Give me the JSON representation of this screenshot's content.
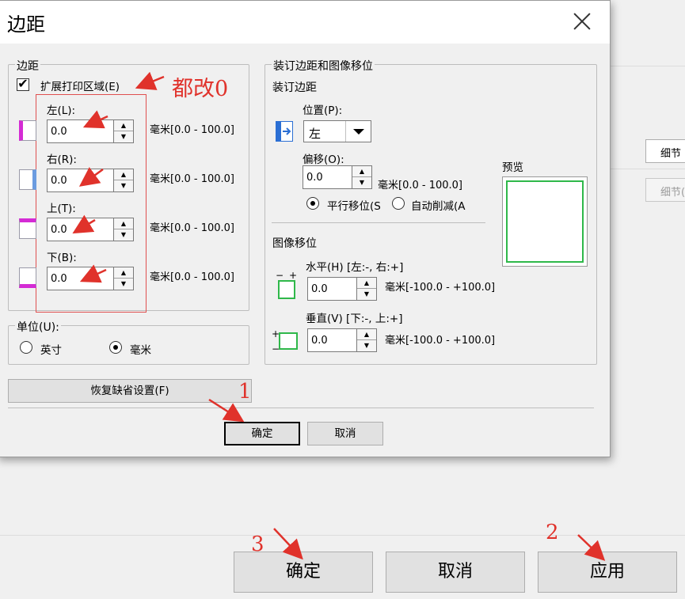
{
  "background": {
    "detail_button": "细节",
    "detail_button2": "细节(",
    "ok": "确定",
    "cancel": "取消",
    "apply": "应用"
  },
  "dialog": {
    "title": "边距",
    "margins_group": {
      "legend": "边距",
      "expand_checkbox": {
        "label": "扩展打印区域(E)",
        "checked": true
      },
      "fields": [
        {
          "label": "左(L):",
          "value": "0.0",
          "unit": "毫米[0.0 - 100.0]",
          "icon": "left-margin-icon"
        },
        {
          "label": "右(R):",
          "value": "0.0",
          "unit": "毫米[0.0 - 100.0]",
          "icon": "right-margin-icon"
        },
        {
          "label": "上(T):",
          "value": "0.0",
          "unit": "毫米[0.0 - 100.0]",
          "icon": "top-margin-icon"
        },
        {
          "label": "下(B):",
          "value": "0.0",
          "unit": "毫米[0.0 - 100.0]",
          "icon": "bottom-margin-icon"
        }
      ]
    },
    "unit_group": {
      "legend": "单位(U):",
      "options": [
        {
          "label": "英寸",
          "selected": false
        },
        {
          "label": "毫米",
          "selected": true
        }
      ]
    },
    "restore_button": "恢复缺省设置(F)",
    "binding_group": {
      "legend": "装订边距和图像移位",
      "binding_title": "装订边距",
      "position_label": "位置(P):",
      "position_value": "左",
      "offset_label": "偏移(O):",
      "offset_value": "0.0",
      "offset_unit": "毫米[0.0 - 100.0]",
      "radio_parallel": "平行移位(S",
      "radio_auto": "自动削减(A",
      "preview_label": "预览",
      "image_shift_title": "图像移位",
      "horizontal_label": "水平(H) [左:-, 右:+]",
      "horizontal_value": "0.0",
      "horizontal_unit": "毫米[-100.0 - +100.0]",
      "vertical_label": "垂直(V) [下:-, 上:+]",
      "vertical_value": "0.0",
      "vertical_unit": "毫米[-100.0 - +100.0]"
    },
    "ok_button": "确定",
    "cancel_button": "取消"
  },
  "annotations": {
    "all_zero": "都改0",
    "step1": "1",
    "step2": "2",
    "step3": "3",
    "color": "#e0322b"
  }
}
